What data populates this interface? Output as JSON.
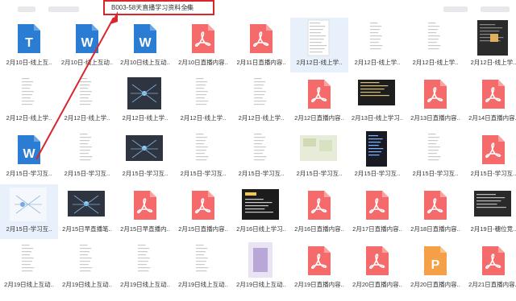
{
  "breadcrumb": {
    "path": "B003-58天直播学习资料全集",
    "chevron": ">"
  },
  "colors": {
    "accent": "#d8262c",
    "word": "#2b7cd3",
    "pdf": "#f56a6a",
    "ppt": "#f5a046"
  },
  "files": [
    {
      "label": "2月10日-线上互..",
      "type": "word-t"
    },
    {
      "label": "2月10日-线上互动..",
      "type": "word"
    },
    {
      "label": "2月10日线上互动..",
      "type": "word"
    },
    {
      "label": "2月10日直播内容..",
      "type": "pdf"
    },
    {
      "label": "2月11日直播内容..",
      "type": "pdf"
    },
    {
      "label": "2月12日-线上学..",
      "type": "doc-light",
      "selected": true
    },
    {
      "label": "2月12日-线上学..",
      "type": "doc-white"
    },
    {
      "label": "2月12日-线上学..",
      "type": "doc-white"
    },
    {
      "label": "2月12日-线上学..",
      "type": "doc-dark"
    },
    {
      "label": "2月12日-线上学..",
      "type": "doc-white"
    },
    {
      "label": "2月12日-线上学..",
      "type": "doc-white"
    },
    {
      "label": "2月12日-线上学..",
      "type": "mind-dark"
    },
    {
      "label": "2月12日-线上学..",
      "type": "doc-white"
    },
    {
      "label": "2月12日-线上学..",
      "type": "doc-white"
    },
    {
      "label": "2月12日直播内容..",
      "type": "pdf"
    },
    {
      "label": "2月13日-线上学习..",
      "type": "dark-text"
    },
    {
      "label": "2月13日直播内容..",
      "type": "pdf"
    },
    {
      "label": "2月14日直播内容..",
      "type": "pdf"
    },
    {
      "label": "2月15日-学习互..",
      "type": "word"
    },
    {
      "label": "2月15日-学习互..",
      "type": "doc-white"
    },
    {
      "label": "2月15日-学习互..",
      "type": "mind-dark-wide"
    },
    {
      "label": "2月15日-学习互..",
      "type": "doc-white"
    },
    {
      "label": "2月15日-学习互..",
      "type": "doc-white"
    },
    {
      "label": "2月15日-学习互..",
      "type": "map-light"
    },
    {
      "label": "2月15日-学习互..",
      "type": "dark-chart"
    },
    {
      "label": "2月15日-学习互..",
      "type": "doc-white"
    },
    {
      "label": "2月15日-学习互..",
      "type": "pdf"
    },
    {
      "label": "2月15日-学习互..",
      "type": "mind-light",
      "selected": true
    },
    {
      "label": "2月15日早直播笔..",
      "type": "mind-dark-wide"
    },
    {
      "label": "2月15日早直播内..",
      "type": "pdf"
    },
    {
      "label": "2月15日直播内容..",
      "type": "pdf"
    },
    {
      "label": "2月16日线上学习..",
      "type": "dark-yellow"
    },
    {
      "label": "2月16日直播内容..",
      "type": "pdf"
    },
    {
      "label": "2月17日直播内容..",
      "type": "pdf"
    },
    {
      "label": "2月18日直播内容..",
      "type": "pdf"
    },
    {
      "label": "2月19日-穗位竞..",
      "type": "dark-table"
    },
    {
      "label": "2月19日线上互动..",
      "type": "doc-white"
    },
    {
      "label": "2月19日线上互动..",
      "type": "doc-white"
    },
    {
      "label": "2月19日线上互动..",
      "type": "doc-white"
    },
    {
      "label": "2月19日线上互动..",
      "type": "doc-white"
    },
    {
      "label": "2月19日线上互动..",
      "type": "purple-doc"
    },
    {
      "label": "2月19日直播内容..",
      "type": "pdf"
    },
    {
      "label": "2月20日直播内容..",
      "type": "pdf"
    },
    {
      "label": "2月20日直播内容..",
      "type": "ppt"
    },
    {
      "label": "2月21日直播内容..",
      "type": "pdf"
    }
  ]
}
